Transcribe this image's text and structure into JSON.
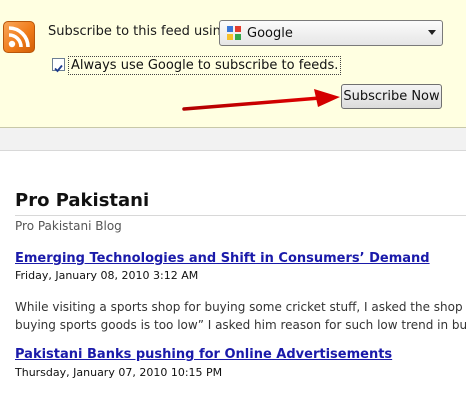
{
  "subscribe": {
    "label": "Subscribe to this feed using",
    "selected_reader": "Google",
    "always_use_text": "Always use Google to subscribe to feeds.",
    "always_use_checked": true,
    "button_label": "Subscribe Now"
  },
  "feed": {
    "title": "Pro Pakistani",
    "subtitle": "Pro Pakistani Blog",
    "posts": [
      {
        "title": "Emerging Technologies and Shift in Consumers’ Demand",
        "date": "Friday, January 08, 2010 3:12 AM",
        "excerpt": [
          "While visiting a sports shop for buying some cricket stuff, I asked the shop ke",
          "buying sports goods is too low” I asked him reason for such low trend in buy"
        ]
      },
      {
        "title": "Pakistani Banks pushing for Online Advertisements",
        "date": "Thursday, January 07, 2010 10:15 PM",
        "excerpt": []
      }
    ]
  },
  "colors": {
    "bar_background": "#ffffe1",
    "link": "#1a1aaa",
    "arrow": "#d40000"
  }
}
